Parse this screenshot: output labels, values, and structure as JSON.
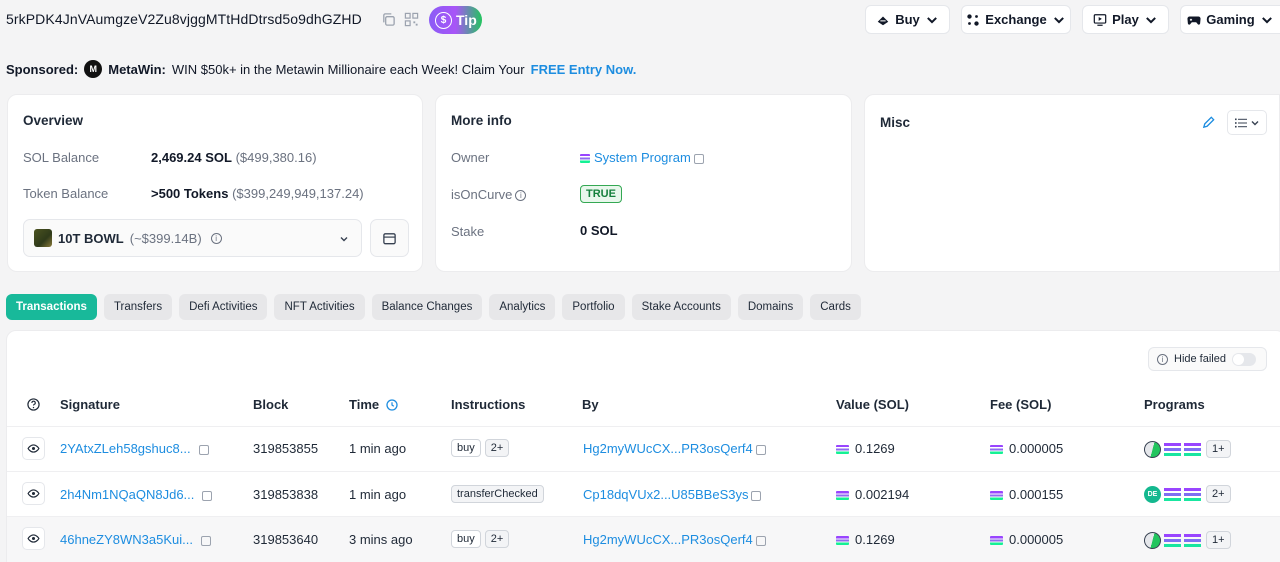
{
  "header": {
    "address": "5rkPDK4JnVAumgzeV2Zu8vjggMTtHdDtrsd5o9dhGZHD",
    "tip_label": "Tip",
    "nav": [
      {
        "label": "Buy",
        "icon": "buy-icon"
      },
      {
        "label": "Exchange",
        "icon": "exchange-icon"
      },
      {
        "label": "Play",
        "icon": "play-icon"
      },
      {
        "label": "Gaming",
        "icon": "gamepad-icon"
      }
    ]
  },
  "sponsor": {
    "prefix": "Sponsored:",
    "brand": "MetaWin:",
    "text": "WIN $50k+ in the Metawin Millionaire each Week! Claim Your",
    "cta": "FREE Entry Now."
  },
  "overview": {
    "title": "Overview",
    "sol_label": "SOL Balance",
    "sol_value": "2,469.24 SOL",
    "sol_usd": "($499,380.16)",
    "token_label": "Token Balance",
    "token_value": ">500 Tokens",
    "token_usd": "($399,249,949,137.24)",
    "selected_token": "10T BOWL",
    "selected_token_value": "(~$399.14B)"
  },
  "more_info": {
    "title": "More info",
    "owner_label": "Owner",
    "owner_value": "System Program",
    "curve_label": "isOnCurve",
    "curve_value": "TRUE",
    "stake_label": "Stake",
    "stake_value": "0 SOL"
  },
  "misc": {
    "title": "Misc"
  },
  "tabs": [
    "Transactions",
    "Transfers",
    "Defi Activities",
    "NFT Activities",
    "Balance Changes",
    "Analytics",
    "Portfolio",
    "Stake Accounts",
    "Domains",
    "Cards"
  ],
  "active_tab": "Transactions",
  "hide_failed_label": "Hide failed",
  "table": {
    "columns": [
      "Signature",
      "Block",
      "Time",
      "Instructions",
      "By",
      "Value (SOL)",
      "Fee (SOL)",
      "Programs"
    ],
    "rows": [
      {
        "signature": "2YAtxZLeh58gshuc8...",
        "block": "319853855",
        "time": "1 min ago",
        "instructions": [
          "buy",
          "2+"
        ],
        "by": "Hg2myWUcCX...PR3osQerf4",
        "value": "0.1269",
        "fee": "0.000005",
        "programs_more": "1+"
      },
      {
        "signature": "2h4Nm1NQaQN8Jd6...",
        "block": "319853838",
        "time": "1 min ago",
        "instructions": [
          "transferChecked"
        ],
        "by": "Cp18dqVUx2...U85BBeS3ys",
        "value": "0.002194",
        "fee": "0.000155",
        "programs_more": "2+"
      },
      {
        "signature": "46hneZY8WN3a5Kui...",
        "block": "319853640",
        "time": "3 mins ago",
        "instructions": [
          "buy",
          "2+"
        ],
        "by": "Hg2myWUcCX...PR3osQerf4",
        "value": "0.1269",
        "fee": "0.000005",
        "programs_more": "1+"
      }
    ]
  }
}
